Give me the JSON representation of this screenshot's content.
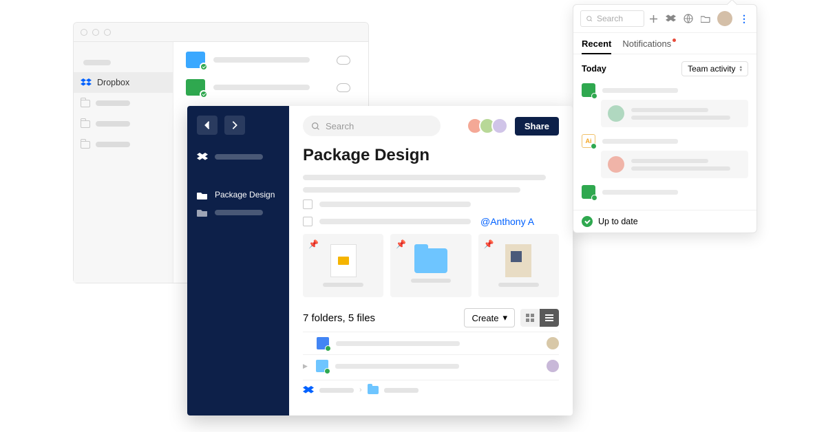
{
  "mac_window": {
    "sidebar": {
      "dropbox_label": "Dropbox"
    }
  },
  "paper": {
    "search_placeholder": "Search",
    "share_label": "Share",
    "title": "Package Design",
    "sidebar_item_label": "Package Design",
    "mention": "@Anthony A",
    "folder_summary": "7 folders, 5 files",
    "create_label": "Create"
  },
  "tray": {
    "search_placeholder": "Search",
    "tabs": {
      "recent": "Recent",
      "notifications": "Notifications"
    },
    "today_label": "Today",
    "filter_label": "Team activity",
    "ai_label": "Ai",
    "footer_status": "Up to date"
  }
}
